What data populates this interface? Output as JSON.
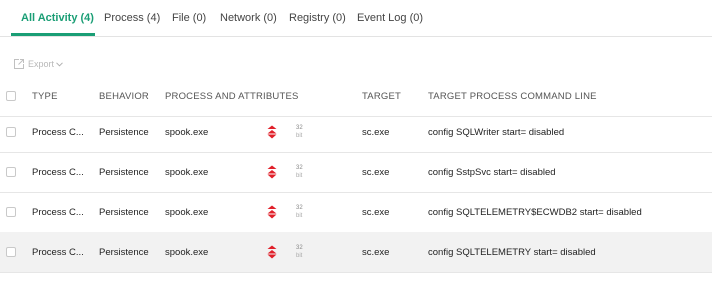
{
  "tabs": [
    {
      "label": "All Activity (4)",
      "active": true
    },
    {
      "label": "Process (4)",
      "active": false
    },
    {
      "label": "File (0)",
      "active": false
    },
    {
      "label": "Network (0)",
      "active": false
    },
    {
      "label": "Registry (0)",
      "active": false
    },
    {
      "label": "Event Log (0)",
      "active": false
    }
  ],
  "toolbar": {
    "export_label": "Export"
  },
  "table": {
    "columns": [
      "TYPE",
      "BEHAVIOR",
      "PROCESS AND ATTRIBUTES",
      "TARGET",
      "TARGET PROCESS COMMAND LINE"
    ],
    "rows": [
      {
        "type": "Process C...",
        "behavior": "Persistence",
        "process": "spook.exe",
        "arch": "32",
        "arch_unit": "bit",
        "target": "sc.exe",
        "command": "config SQLWriter start= disabled"
      },
      {
        "type": "Process C...",
        "behavior": "Persistence",
        "process": "spook.exe",
        "arch": "32",
        "arch_unit": "bit",
        "target": "sc.exe",
        "command": "config SstpSvc start= disabled"
      },
      {
        "type": "Process C...",
        "behavior": "Persistence",
        "process": "spook.exe",
        "arch": "32",
        "arch_unit": "bit",
        "target": "sc.exe",
        "command": "config SQLTELEMETRY$ECWDB2 start= disabled"
      },
      {
        "type": "Process C...",
        "behavior": "Persistence",
        "process": "spook.exe",
        "arch": "32",
        "arch_unit": "bit",
        "target": "sc.exe",
        "command": "config SQLTELEMETRY start= disabled"
      }
    ]
  },
  "colors": {
    "accent": "#1a9e75",
    "severity": "#e0202a",
    "row_shaded": "#f2f2f2"
  },
  "icons": {
    "export": "export-icon",
    "severity": "severity-high-icon"
  }
}
